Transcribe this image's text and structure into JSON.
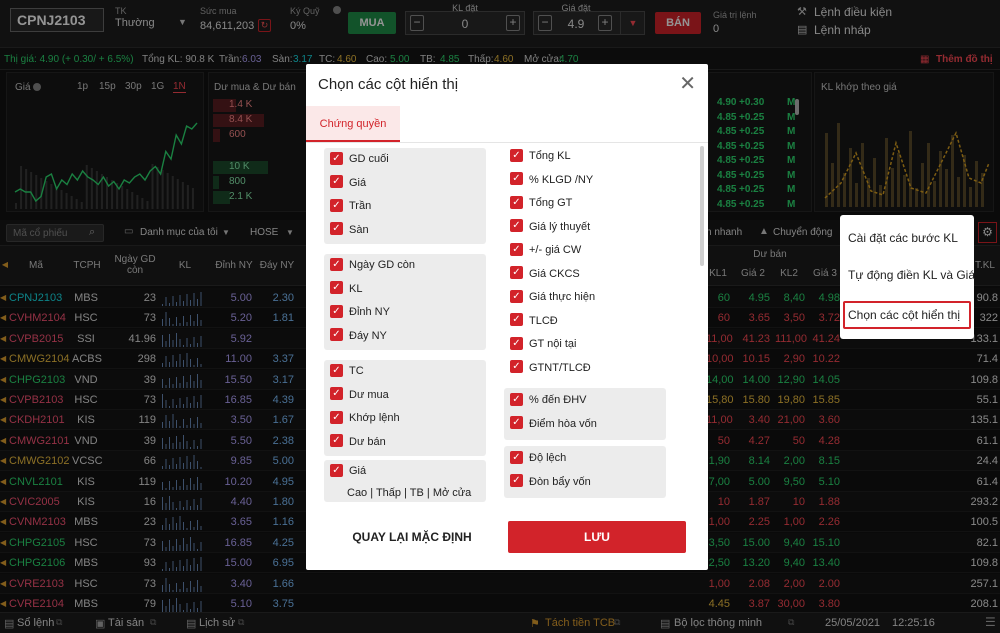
{
  "order": {
    "symbol": "CPNJ2103",
    "account_label": "TK",
    "account_value": "Thường",
    "buy_power_label": "Sức mua",
    "buy_power_value": "84,611,203",
    "margin_label": "Ký Quỹ",
    "margin_value": "0%",
    "buy_label": "MUA",
    "qty_label": "KL đặt",
    "qty_value": "0",
    "price_label": "Giá đặt",
    "price_value": "4.9",
    "sell_label": "BÁN",
    "order_value_label": "Giá trị lệnh",
    "order_value": "0",
    "cond_order": "Lệnh điều kiện",
    "draft_order": "Lệnh nháp"
  },
  "info": {
    "price": "Thị giá: 4.90 (+ 0.30/ + 6.5%)",
    "vol": "Tổng KL: 90.8 K",
    "ceil_lbl": "Trần:",
    "ceil": "6.03",
    "floor_lbl": "Sàn:",
    "floor": "3.17",
    "ref_lbl": "TC:",
    "ref": "4.60",
    "high_lbl": "Cao:",
    "high": "5.00",
    "avg_lbl": "TB:",
    "avg": "4.85",
    "low_lbl": "Thấp:",
    "low": "4.60",
    "open_lbl": "Mở cửa:",
    "open": "4.70",
    "add_chart": "Thêm đồ thị"
  },
  "chart": {
    "label": "Giá",
    "ranges": [
      "1p",
      "15p",
      "30p",
      "1G",
      "1N"
    ],
    "active": "1N",
    "values": [
      28,
      30,
      28,
      28,
      22,
      25,
      38,
      40,
      30,
      36,
      33,
      40,
      36,
      42,
      38,
      36,
      33,
      38,
      32,
      35,
      30,
      36,
      34,
      38,
      40,
      36,
      42,
      45,
      40,
      55,
      50,
      66,
      60,
      72,
      70,
      74
    ]
  },
  "depth": {
    "label": "Dư mua & Dư bán",
    "buy": [
      "1.4 K",
      "8.4 K",
      "600"
    ],
    "sell": [
      "10 K",
      "800",
      "2.1 K"
    ],
    "buy_fill": [
      0.25,
      0.55,
      0.08
    ],
    "sell_fill": [
      0.6,
      0.06,
      0.18
    ]
  },
  "ticks": {
    "rows": [
      [
        "4.90",
        "+0.30",
        "M"
      ],
      [
        "4.85",
        "+0.25",
        "M"
      ],
      [
        "4.85",
        "+0.25",
        "M"
      ],
      [
        "4.85",
        "+0.25",
        "M"
      ],
      [
        "4.85",
        "+0.25",
        "M"
      ],
      [
        "4.85",
        "+0.25",
        "M"
      ],
      [
        "4.85",
        "+0.25",
        "M"
      ],
      [
        "4.85",
        "+0.25",
        "M"
      ]
    ]
  },
  "kl_chart": {
    "label": "KL khớp theo giá"
  },
  "toolbar": {
    "search_placeholder": "Mã cổ phiếu",
    "watchlist": "Danh mục của tôi",
    "exchange": "HOSE",
    "quick": "n nhanh",
    "moves": "Chuyển động"
  },
  "table": {
    "h_sym": "Mã",
    "h_tcph": "TCPH",
    "h_gd": "Ngày GD còn",
    "h_kl": "KL",
    "h_dinh": "Đỉnh NY",
    "h_day": "Đáy NY",
    "h_duban": "Dư bán",
    "h_kl1": "KL1",
    "h_gia2": "Giá 2",
    "h_kl2": "KL2",
    "h_gia3": "Giá 3",
    "h_tkl": "T.KL",
    "rows": [
      {
        "sym": "CPNJ2103",
        "color": "cyan",
        "tc": "MBS",
        "gd": "23",
        "dinh": "5.00",
        "day": "2.30",
        "extra": [
          [
            "60",
            "grn"
          ],
          [
            "4.95",
            "grn"
          ],
          [
            "8,40",
            "grn"
          ],
          [
            "4.98",
            "grn"
          ]
        ],
        "tkl": "90.8"
      },
      {
        "sym": "CVHM2104",
        "color": "pink",
        "tc": "HSC",
        "gd": "73",
        "dinh": "5.20",
        "day": "1.81",
        "extra": [
          [
            "60",
            "red"
          ],
          [
            "3.65",
            "red"
          ],
          [
            "3,50",
            "red"
          ],
          [
            "3.72",
            "red"
          ]
        ],
        "tkl": "322"
      },
      {
        "sym": "CVPB2015",
        "color": "pink",
        "tc": "SSI",
        "gd": "41.96",
        "dinh": "5.92",
        "day": "",
        "extra": [
          [
            "11,00",
            "red"
          ],
          [
            "41.23",
            "red"
          ],
          [
            "111,00",
            "red"
          ],
          [
            "41.24",
            "red"
          ]
        ],
        "tkl": "133.1"
      },
      {
        "sym": "CMWG2104",
        "color": "yel",
        "tc": "ACBS",
        "gd": "298",
        "dinh": "11.00",
        "day": "3.37",
        "extra": [
          [
            "10,00",
            "red"
          ],
          [
            "10.15",
            "red"
          ],
          [
            "2,90",
            "red"
          ],
          [
            "10.22",
            "red"
          ]
        ],
        "tkl": "71.4"
      },
      {
        "sym": "CHPG2103",
        "color": "grn",
        "tc": "VND",
        "gd": "39",
        "dinh": "15.50",
        "day": "3.17",
        "extra": [
          [
            "14,00",
            "grn"
          ],
          [
            "14.00",
            "grn"
          ],
          [
            "12,90",
            "grn"
          ],
          [
            "14.05",
            "grn"
          ]
        ],
        "tkl": "109.8"
      },
      {
        "sym": "CVPB2103",
        "color": "pink",
        "tc": "HSC",
        "gd": "73",
        "dinh": "16.85",
        "day": "4.39",
        "extra": [
          [
            "15,80",
            "yel"
          ],
          [
            "15.80",
            "yel"
          ],
          [
            "19,80",
            "yel"
          ],
          [
            "15.85",
            "yel"
          ]
        ],
        "tkl": "55.1"
      },
      {
        "sym": "CKDH2101",
        "color": "pink",
        "tc": "KIS",
        "gd": "119",
        "dinh": "3.50",
        "day": "1.67",
        "extra": [
          [
            "11,00",
            "red"
          ],
          [
            "3.40",
            "red"
          ],
          [
            "21,00",
            "red"
          ],
          [
            "3.60",
            "red"
          ]
        ],
        "tkl": "135.1"
      },
      {
        "sym": "CMWG2101",
        "color": "pink",
        "tc": "VND",
        "gd": "39",
        "dinh": "5.50",
        "day": "2.38",
        "extra": [
          [
            "50",
            "red"
          ],
          [
            "4.27",
            "red"
          ],
          [
            "50",
            "red"
          ],
          [
            "4.28",
            "red"
          ]
        ],
        "tkl": "61.1"
      },
      {
        "sym": "CMWG2102",
        "color": "yel",
        "tc": "VCSC",
        "gd": "66",
        "dinh": "9.85",
        "day": "5.00",
        "extra": [
          [
            "1,90",
            "grn"
          ],
          [
            "8.14",
            "grn"
          ],
          [
            "2,00",
            "grn"
          ],
          [
            "8.15",
            "grn"
          ]
        ],
        "tkl": "24.4"
      },
      {
        "sym": "CNVL2101",
        "color": "grn",
        "tc": "KIS",
        "gd": "119",
        "dinh": "10.20",
        "day": "4.95",
        "extra": [
          [
            "7,00",
            "grn"
          ],
          [
            "5.00",
            "grn"
          ],
          [
            "9,50",
            "grn"
          ],
          [
            "5.10",
            "grn"
          ]
        ],
        "tkl": "61.4"
      },
      {
        "sym": "CVIC2005",
        "color": "pink",
        "tc": "KIS",
        "gd": "16",
        "dinh": "4.40",
        "day": "1.80",
        "extra": [
          [
            "10",
            "red"
          ],
          [
            "1.87",
            "red"
          ],
          [
            "10",
            "red"
          ],
          [
            "1.88",
            "red"
          ]
        ],
        "tkl": "293.2"
      },
      {
        "sym": "CVNM2103",
        "color": "pink",
        "tc": "MBS",
        "gd": "23",
        "dinh": "3.65",
        "day": "1.16",
        "extra": [
          [
            "1,00",
            "red"
          ],
          [
            "2.25",
            "red"
          ],
          [
            "1,00",
            "red"
          ],
          [
            "2.26",
            "red"
          ]
        ],
        "tkl": "100.5"
      },
      {
        "sym": "CHPG2105",
        "color": "grn",
        "tc": "HSC",
        "gd": "73",
        "dinh": "16.85",
        "day": "4.25",
        "extra": [
          [
            "3,50",
            "grn"
          ],
          [
            "15.00",
            "grn"
          ],
          [
            "9,40",
            "grn"
          ],
          [
            "15.10",
            "grn"
          ]
        ],
        "tkl": "82.1"
      },
      {
        "sym": "CHPG2106",
        "color": "grn",
        "tc": "MBS",
        "gd": "93",
        "dinh": "15.00",
        "day": "6.95",
        "extra": [
          [
            "2,50",
            "grn"
          ],
          [
            "13.20",
            "grn"
          ],
          [
            "9,40",
            "grn"
          ],
          [
            "13.40",
            "grn"
          ]
        ],
        "tkl": "109.8"
      },
      {
        "sym": "CVRE2103",
        "color": "pink",
        "tc": "HSC",
        "gd": "73",
        "dinh": "3.40",
        "day": "1.66",
        "extra": [
          [
            "1,00",
            "red"
          ],
          [
            "2.08",
            "red"
          ],
          [
            "2,00",
            "red"
          ],
          [
            "2.00",
            "red"
          ]
        ],
        "tkl": "257.1"
      },
      {
        "sym": "CVRE2104",
        "color": "pink",
        "tc": "MBS",
        "gd": "79",
        "dinh": "5.10",
        "day": "3.75",
        "extra": [
          [
            "4.45",
            "yel"
          ],
          [
            "3.87",
            "red"
          ],
          [
            "30,00",
            "red"
          ],
          [
            "3.80",
            "red"
          ]
        ],
        "tkl": "208.1"
      }
    ]
  },
  "modal": {
    "title": "Chọn các cột hiển thị",
    "tab": "Chứng quyền",
    "left": [
      [
        "GD cuối",
        "Giá",
        "Trần",
        "Sàn"
      ],
      [
        "Ngày GD còn",
        "KL",
        "Đỉnh NY",
        "Đáy NY"
      ],
      [
        "TC",
        "Dư mua",
        "Khớp lệnh",
        "Dư bán"
      ],
      [
        "Giá"
      ]
    ],
    "left_sub": "Cao | Thấp | TB | Mở cửa",
    "right": [
      [
        "Tổng KL",
        "% KLGD /NY",
        "Tổng GT",
        "Giá lý thuyết",
        "+/- giá CW",
        "Giá CKCS",
        "Giá thực hiện",
        "TLCĐ",
        "GT nội tại",
        "GTNT/TLCĐ"
      ],
      [
        "% đến ĐHV",
        "Điểm hòa vốn"
      ],
      [
        "Độ lệch",
        "Đòn bẩy vốn"
      ]
    ],
    "reset": "QUAY LẠI MẶC ĐỊNH",
    "save": "LƯU"
  },
  "menu": {
    "items": [
      "Cài đặt các bước KL",
      "Tự động điền KL và Giá",
      "Chọn các cột hiển thị"
    ]
  },
  "footer": {
    "orders": "Sổ lệnh",
    "assets": "Tài sản",
    "history": "Lịch sử",
    "split": "Tách tiền TCB",
    "filter": "Bộ lọc thông minh",
    "date": "25/05/2021",
    "time": "12:25:16"
  }
}
